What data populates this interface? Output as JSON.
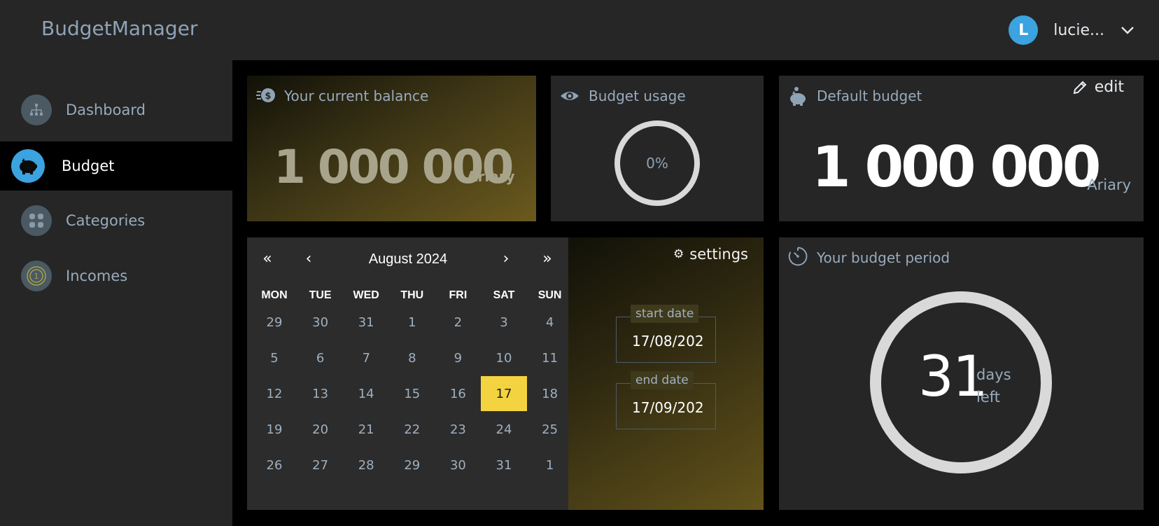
{
  "header": {
    "brand": "BudgetManager",
    "user_initial": "L",
    "user_name": "lucie..."
  },
  "sidebar": {
    "items": [
      {
        "label": "Dashboard",
        "icon": "sitemap-icon",
        "active": false
      },
      {
        "label": "Budget",
        "icon": "piggy-bank-icon",
        "active": true
      },
      {
        "label": "Categories",
        "icon": "categories-icon",
        "active": false
      },
      {
        "label": "Incomes",
        "icon": "coin-icon",
        "active": false
      }
    ]
  },
  "balance": {
    "title": "Your current balance",
    "amount": "1 000 000",
    "unit": "Ariary"
  },
  "usage": {
    "title": "Budget usage",
    "value": "0%",
    "fraction": 0
  },
  "default_budget": {
    "title": "Default budget",
    "edit_label": "edit",
    "amount": "1 000 000",
    "unit": "Ariary"
  },
  "calendar": {
    "nav": {
      "prev_year": "«",
      "prev_month": "‹",
      "next_month": "›",
      "next_year": "»"
    },
    "title": "August 2024",
    "weekdays": [
      "MON",
      "TUE",
      "WED",
      "THU",
      "FRI",
      "SAT",
      "SUN"
    ],
    "weeks": [
      [
        "29",
        "30",
        "31",
        "1",
        "2",
        "3",
        "4"
      ],
      [
        "5",
        "6",
        "7",
        "8",
        "9",
        "10",
        "11"
      ],
      [
        "12",
        "13",
        "14",
        "15",
        "16",
        "17",
        "18"
      ],
      [
        "19",
        "20",
        "21",
        "22",
        "23",
        "24",
        "25"
      ],
      [
        "26",
        "27",
        "28",
        "29",
        "30",
        "31",
        "1"
      ]
    ],
    "selected": "17"
  },
  "dates": {
    "settings_label": "settings",
    "start_label": "start date",
    "start_value": "17/08/202",
    "end_label": "end date",
    "end_value": "17/09/202"
  },
  "period": {
    "title": "Your budget period",
    "days": "31",
    "unit_line1": "days",
    "unit_line2": "left"
  },
  "colors": {
    "accent_blue": "#3aa3e0",
    "selected_day": "#f3d33f",
    "panel": "#262626",
    "background": "#000000"
  }
}
